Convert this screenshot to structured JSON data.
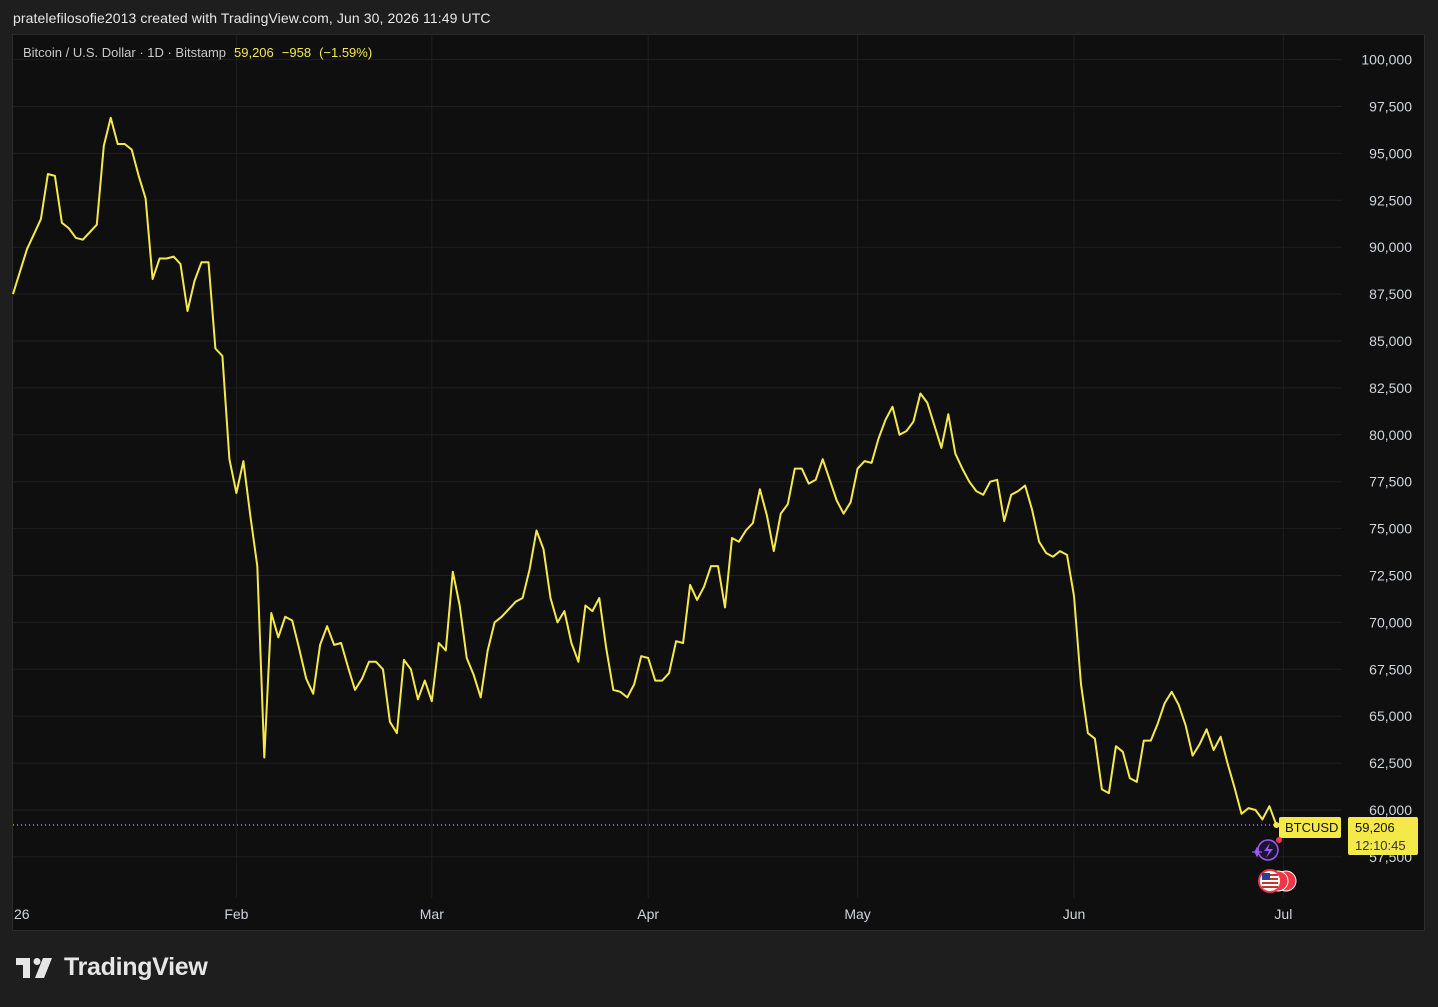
{
  "header": {
    "attribution": "pratelefilosofie2013 created with TradingView.com, Jun 30, 2026 11:49 UTC"
  },
  "legend": {
    "symbol_label": "Bitcoin / U.S. Dollar · 1D · Bitstamp",
    "last_price": "59,206",
    "change": "−958",
    "change_pct": "(−1.59%)"
  },
  "price_tag": {
    "symbol": "BTCUSD",
    "price": "59,206",
    "countdown": "12:10:45"
  },
  "footer": {
    "brand": "TradingView"
  },
  "colors": {
    "line": "#f5e94a",
    "background": "#0f0f0f",
    "grid": "#1f1f1f",
    "axis_text": "#d1d4dc"
  },
  "chart_data": {
    "type": "line",
    "title": "Bitcoin / U.S. Dollar · 1D · Bitstamp",
    "xlabel": "",
    "ylabel": "",
    "ylim": [
      55800,
      101400
    ],
    "grid": true,
    "y_ticks": [
      "57,500",
      "60,000",
      "62,500",
      "65,000",
      "67,500",
      "70,000",
      "72,500",
      "75,000",
      "77,500",
      "80,000",
      "82,500",
      "85,000",
      "87,500",
      "90,000",
      "92,500",
      "95,000",
      "97,500",
      "100,000"
    ],
    "x_ticks": [
      {
        "label": "26",
        "day": 0
      },
      {
        "label": "Feb",
        "day": 31
      },
      {
        "label": "Mar",
        "day": 59
      },
      {
        "label": "Apr",
        "day": 90
      },
      {
        "label": "May",
        "day": 120
      },
      {
        "label": "Jun",
        "day": 151
      },
      {
        "label": "Jul",
        "day": 181
      }
    ],
    "series": [
      {
        "values": [
          [
            -1,
            87500
          ],
          [
            0,
            88700
          ],
          [
            1,
            89900
          ],
          [
            2,
            90700
          ],
          [
            3,
            91500
          ],
          [
            4,
            93900
          ],
          [
            5,
            93800
          ],
          [
            6,
            91300
          ],
          [
            7,
            91000
          ],
          [
            8,
            90500
          ],
          [
            9,
            90400
          ],
          [
            10,
            90800
          ],
          [
            11,
            91200
          ],
          [
            12,
            95400
          ],
          [
            13,
            96900
          ],
          [
            14,
            95500
          ],
          [
            15,
            95500
          ],
          [
            16,
            95200
          ],
          [
            17,
            93800
          ],
          [
            18,
            92600
          ],
          [
            19,
            88300
          ],
          [
            20,
            89400
          ],
          [
            21,
            89400
          ],
          [
            22,
            89500
          ],
          [
            23,
            89100
          ],
          [
            24,
            86600
          ],
          [
            25,
            88200
          ],
          [
            26,
            89200
          ],
          [
            27,
            89200
          ],
          [
            28,
            84600
          ],
          [
            29,
            84200
          ],
          [
            30,
            78700
          ],
          [
            31,
            76900
          ],
          [
            32,
            78600
          ],
          [
            33,
            75700
          ],
          [
            34,
            73000
          ],
          [
            35,
            62800
          ],
          [
            36,
            70500
          ],
          [
            37,
            69200
          ],
          [
            38,
            70300
          ],
          [
            39,
            70100
          ],
          [
            40,
            68600
          ],
          [
            41,
            67000
          ],
          [
            42,
            66200
          ],
          [
            43,
            68800
          ],
          [
            44,
            69800
          ],
          [
            45,
            68800
          ],
          [
            46,
            68900
          ],
          [
            47,
            67600
          ],
          [
            48,
            66400
          ],
          [
            49,
            67000
          ],
          [
            50,
            67900
          ],
          [
            51,
            67900
          ],
          [
            52,
            67500
          ],
          [
            53,
            64700
          ],
          [
            54,
            64100
          ],
          [
            55,
            68000
          ],
          [
            56,
            67500
          ],
          [
            57,
            65900
          ],
          [
            58,
            66900
          ],
          [
            59,
            65800
          ],
          [
            60,
            68900
          ],
          [
            61,
            68500
          ],
          [
            62,
            72700
          ],
          [
            63,
            70900
          ],
          [
            64,
            68100
          ],
          [
            65,
            67200
          ],
          [
            66,
            66000
          ],
          [
            67,
            68500
          ],
          [
            68,
            70000
          ],
          [
            69,
            70300
          ],
          [
            70,
            70700
          ],
          [
            71,
            71100
          ],
          [
            72,
            71300
          ],
          [
            73,
            72800
          ],
          [
            74,
            74900
          ],
          [
            75,
            73900
          ],
          [
            76,
            71300
          ],
          [
            77,
            70000
          ],
          [
            78,
            70600
          ],
          [
            79,
            68900
          ],
          [
            80,
            67900
          ],
          [
            81,
            70900
          ],
          [
            82,
            70600
          ],
          [
            83,
            71300
          ],
          [
            84,
            68600
          ],
          [
            85,
            66400
          ],
          [
            86,
            66300
          ],
          [
            87,
            66000
          ],
          [
            88,
            66700
          ],
          [
            89,
            68200
          ],
          [
            90,
            68100
          ],
          [
            91,
            66900
          ],
          [
            92,
            66900
          ],
          [
            93,
            67300
          ],
          [
            94,
            69000
          ],
          [
            95,
            68900
          ],
          [
            96,
            72000
          ],
          [
            97,
            71200
          ],
          [
            98,
            71900
          ],
          [
            99,
            73000
          ],
          [
            100,
            73000
          ],
          [
            101,
            70800
          ],
          [
            102,
            74500
          ],
          [
            103,
            74300
          ],
          [
            104,
            74900
          ],
          [
            105,
            75300
          ],
          [
            106,
            77100
          ],
          [
            107,
            75700
          ],
          [
            108,
            73800
          ],
          [
            109,
            75800
          ],
          [
            110,
            76300
          ],
          [
            111,
            78200
          ],
          [
            112,
            78200
          ],
          [
            113,
            77400
          ],
          [
            114,
            77600
          ],
          [
            115,
            78700
          ],
          [
            116,
            77600
          ],
          [
            117,
            76500
          ],
          [
            118,
            75800
          ],
          [
            119,
            76400
          ],
          [
            120,
            78200
          ],
          [
            121,
            78600
          ],
          [
            122,
            78500
          ],
          [
            123,
            79800
          ],
          [
            124,
            80800
          ],
          [
            125,
            81500
          ],
          [
            126,
            80000
          ],
          [
            127,
            80200
          ],
          [
            128,
            80700
          ],
          [
            129,
            82200
          ],
          [
            130,
            81700
          ],
          [
            131,
            80500
          ],
          [
            132,
            79300
          ],
          [
            133,
            81100
          ],
          [
            134,
            79000
          ],
          [
            135,
            78200
          ],
          [
            136,
            77500
          ],
          [
            137,
            77000
          ],
          [
            138,
            76800
          ],
          [
            139,
            77500
          ],
          [
            140,
            77600
          ],
          [
            141,
            75400
          ],
          [
            142,
            76800
          ],
          [
            143,
            77000
          ],
          [
            144,
            77300
          ],
          [
            145,
            76000
          ],
          [
            146,
            74300
          ],
          [
            147,
            73700
          ],
          [
            148,
            73500
          ],
          [
            149,
            73800
          ],
          [
            150,
            73600
          ],
          [
            151,
            71400
          ],
          [
            152,
            66700
          ],
          [
            153,
            64100
          ],
          [
            154,
            63800
          ],
          [
            155,
            61100
          ],
          [
            156,
            60900
          ],
          [
            157,
            63400
          ],
          [
            158,
            63100
          ],
          [
            159,
            61700
          ],
          [
            160,
            61500
          ],
          [
            161,
            63700
          ],
          [
            162,
            63700
          ],
          [
            163,
            64600
          ],
          [
            164,
            65700
          ],
          [
            165,
            66300
          ],
          [
            166,
            65600
          ],
          [
            167,
            64500
          ],
          [
            168,
            62900
          ],
          [
            169,
            63500
          ],
          [
            170,
            64300
          ],
          [
            171,
            63200
          ],
          [
            172,
            63900
          ],
          [
            173,
            62500
          ],
          [
            174,
            61200
          ],
          [
            175,
            59800
          ],
          [
            176,
            60100
          ],
          [
            177,
            60000
          ],
          [
            178,
            59500
          ],
          [
            179,
            60200
          ],
          [
            180,
            59200
          ]
        ]
      }
    ]
  }
}
